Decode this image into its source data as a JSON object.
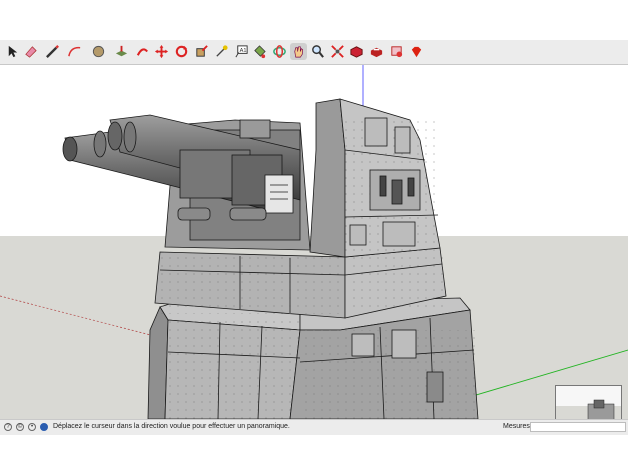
{
  "toolbar": {
    "tools": [
      {
        "id": "select",
        "icon": "select-arrow-icon"
      },
      {
        "id": "eraser",
        "icon": "eraser-icon"
      },
      {
        "id": "line",
        "icon": "pencil-line-icon"
      },
      {
        "id": "arc",
        "icon": "arc-icon"
      },
      {
        "id": "shapes",
        "icon": "circle-shapes-icon"
      },
      {
        "id": "push-pull",
        "icon": "push-pull-icon"
      },
      {
        "id": "follow-me",
        "icon": "follow-me-icon"
      },
      {
        "id": "move",
        "icon": "move-icon"
      },
      {
        "id": "rotate",
        "icon": "rotate-icon"
      },
      {
        "id": "scale",
        "icon": "scale-icon"
      },
      {
        "id": "tape",
        "icon": "tape-measure-icon"
      },
      {
        "id": "text",
        "icon": "text-label-icon"
      },
      {
        "id": "paint",
        "icon": "paint-bucket-icon"
      },
      {
        "id": "orbit",
        "icon": "orbit-icon"
      },
      {
        "id": "pan",
        "icon": "pan-hand-icon",
        "active": true
      },
      {
        "id": "zoom",
        "icon": "zoom-magnifier-icon"
      },
      {
        "id": "zoom-extents",
        "icon": "zoom-extents-icon"
      },
      {
        "id": "warehouse",
        "icon": "3d-warehouse-icon"
      },
      {
        "id": "extension-warehouse",
        "icon": "extension-warehouse-icon"
      },
      {
        "id": "layout",
        "icon": "send-to-layout-icon"
      },
      {
        "id": "ruby",
        "icon": "ruby-console-icon"
      }
    ]
  },
  "status": {
    "message": "Déplacez le curseur dans la direction voulue pour effectuer un panoramique.",
    "measure_label": "Mesures",
    "measure_value": "",
    "icons": [
      "help-icon",
      "credits-icon",
      "user-icon",
      "geolocation-icon"
    ]
  },
  "colors": {
    "sky": "#ffffff",
    "ground": "#d9d9d4",
    "toolbar": "#ececec",
    "model": "#b3b3b3",
    "edges": "#1a1a1a",
    "axis_blue": "#3a3aff",
    "axis_green": "#22b422",
    "axis_red": "#b04040"
  }
}
